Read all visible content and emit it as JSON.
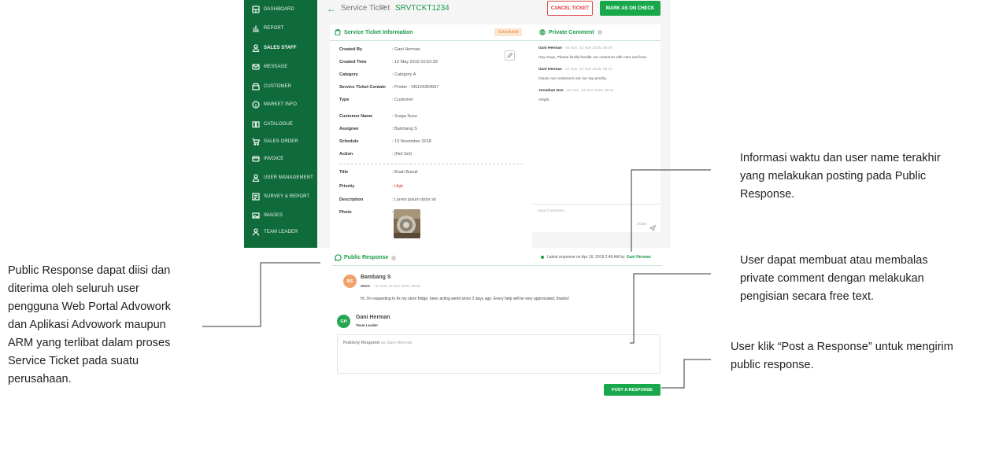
{
  "sidebar": {
    "items": [
      {
        "label": "DASHBOARD",
        "icon": "dashboard-icon"
      },
      {
        "label": "REPORT",
        "icon": "report-icon"
      },
      {
        "label": "SALES STAFF",
        "icon": "sales-staff-icon"
      },
      {
        "label": "MESSAGE",
        "icon": "message-icon"
      },
      {
        "label": "CUSTOMER",
        "icon": "customer-icon"
      },
      {
        "label": "MARKET INFO",
        "icon": "market-info-icon"
      },
      {
        "label": "CATALOGUE",
        "icon": "catalogue-icon"
      },
      {
        "label": "SALES ORDER",
        "icon": "cart-icon"
      },
      {
        "label": "INVOICE",
        "icon": "invoice-icon"
      },
      {
        "label": "USER MANAGEMENT",
        "icon": "user-management-icon"
      },
      {
        "label": "SURVEY & REPORT",
        "icon": "survey-icon"
      },
      {
        "label": "IMAGES",
        "icon": "images-icon"
      },
      {
        "label": "TEAM LEADER",
        "icon": "team-leader-icon"
      }
    ]
  },
  "header": {
    "breadcrumb_parent": "Service Ticket",
    "breadcrumb_separator": ">",
    "ticket_id": "SRVTCKT1234",
    "cancel_label": "CANCEL TICKET",
    "check_label": "MARK AS ON CHECK"
  },
  "info": {
    "title": "Service Ticket Information",
    "status": "Scheduled",
    "fields": [
      {
        "label": "Created By",
        "value": ": Gani Herman"
      },
      {
        "label": "Created Time",
        "value": ": 12 May 2019 10:52:39"
      },
      {
        "label": "Category",
        "value": ": Category A"
      },
      {
        "label": "Service Ticket Contain",
        "value": ": Printer - SN124354567"
      },
      {
        "label": "Type",
        "value": ": Customer"
      },
      {
        "label": "Customer Name",
        "value": ": Surga Susu"
      },
      {
        "label": "Assignee",
        "value": ": Bambang S"
      },
      {
        "label": "Schedule",
        "value": ": 13 November 2018"
      },
      {
        "label": "Action",
        "value": ": (Not Set)"
      },
      {
        "label": "Title",
        "value": ": Buah Busuk"
      },
      {
        "label": "Priority",
        "value": ": High"
      },
      {
        "label": "Description",
        "value": ": Lorem ipsum dolor sit"
      },
      {
        "label": "Photo",
        "value": ":"
      }
    ]
  },
  "private_comment": {
    "title": "Private Comment",
    "comments": [
      {
        "author": "Gani Herman",
        "meta": "- on Sun, 13 Nov 2018, 09:40",
        "text": "Hey Guys, Please kindly handle our customer with care and love."
      },
      {
        "author": "Gani Herman",
        "meta": "- on Sun, 13 Nov 2018, 09:41",
        "text": "Cause our customers are our top priority."
      },
      {
        "author": "Jonathan Doe",
        "meta": "- on Sun, 13 Nov 2018, 09:41",
        "text": "Alright."
      }
    ],
    "input_placeholder": "Input Comment...",
    "char_count": "0/300"
  },
  "public_response": {
    "title": "Public Response",
    "latest_prefix": "Latest response on Apr 16, 2019 2:46 AM by",
    "latest_user": "Gani Herman",
    "post": {
      "initials": "BS",
      "name": "Bambang S",
      "role": "Store",
      "meta": "- on Sun, 22 Nov 2018, 09:40",
      "message": "Hi, I'm requesting to fix my store fridge, been acting weird since 2 days ago. Every help will be very appreciated, thanks!"
    },
    "responder": {
      "initials": "GH",
      "name": "Gani Herman",
      "role": "Team Leader"
    },
    "placeholder_strong": "Publicly Respond",
    "placeholder_rest": "as Gani Herman",
    "post_label": "POST A RESPONSE"
  },
  "annotations": {
    "left_note": [
      "Public Response dapat diisi dan",
      "diterima oleh seluruh user",
      "pengguna Web Portal Advowork",
      "dan Aplikasi Advowork maupun",
      "ARM  yang terlibat dalam proses",
      "Service Ticket pada suatu",
      "perusahaan."
    ],
    "right_note_1": [
      "Informasi waktu dan user name terakhir",
      "yang melakukan posting pada Public",
      "Response."
    ],
    "right_note_2": [
      "User dapat membuat atau membalas",
      "private comment dengan melakukan",
      "pengisian secara free text."
    ],
    "right_note_3": [
      "User klik “Post a Response” untuk mengirim",
      "public response."
    ]
  },
  "colors": {
    "sidebar_green": "#0f6b3a",
    "brand_green": "#18a84b",
    "danger_red": "#e03b3b",
    "scheduled_orange": "#e0883a"
  }
}
